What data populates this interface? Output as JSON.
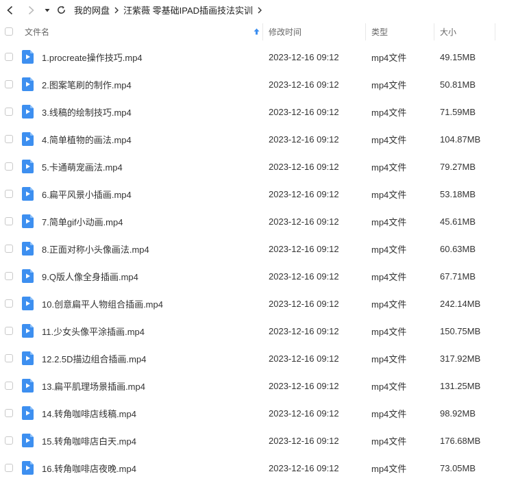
{
  "breadcrumb": [
    "我的网盘",
    "汪紫薇 零基础IPAD插画技法实训"
  ],
  "columns": {
    "name": "文件名",
    "modified": "修改时间",
    "type": "类型",
    "size": "大小"
  },
  "colors": {
    "icon_blue": "#3d8ff0",
    "sort_arrow": "#3d8ff0"
  },
  "files": [
    {
      "name": "1.procreate操作技巧.mp4",
      "date": "2023-12-16 09:12",
      "type": "mp4文件",
      "size": "49.15MB"
    },
    {
      "name": "2.图案笔刷的制作.mp4",
      "date": "2023-12-16 09:12",
      "type": "mp4文件",
      "size": "50.81MB"
    },
    {
      "name": "3.线稿的绘制技巧.mp4",
      "date": "2023-12-16 09:12",
      "type": "mp4文件",
      "size": "71.59MB"
    },
    {
      "name": "4.简单植物的画法.mp4",
      "date": "2023-12-16 09:12",
      "type": "mp4文件",
      "size": "104.87MB"
    },
    {
      "name": "5.卡通萌宠画法.mp4",
      "date": "2023-12-16 09:12",
      "type": "mp4文件",
      "size": "79.27MB"
    },
    {
      "name": "6.扁平风景小插画.mp4",
      "date": "2023-12-16 09:12",
      "type": "mp4文件",
      "size": "53.18MB"
    },
    {
      "name": "7.简单gif小动画.mp4",
      "date": "2023-12-16 09:12",
      "type": "mp4文件",
      "size": "45.61MB"
    },
    {
      "name": "8.正面对称小头像画法.mp4",
      "date": "2023-12-16 09:12",
      "type": "mp4文件",
      "size": "60.63MB"
    },
    {
      "name": "9.Q版人像全身插画.mp4",
      "date": "2023-12-16 09:12",
      "type": "mp4文件",
      "size": "67.71MB"
    },
    {
      "name": "10.创意扁平人物组合插画.mp4",
      "date": "2023-12-16 09:12",
      "type": "mp4文件",
      "size": "242.14MB"
    },
    {
      "name": "11.少女头像平涂插画.mp4",
      "date": "2023-12-16 09:12",
      "type": "mp4文件",
      "size": "150.75MB"
    },
    {
      "name": "12.2.5D描边组合插画.mp4",
      "date": "2023-12-16 09:12",
      "type": "mp4文件",
      "size": "317.92MB"
    },
    {
      "name": "13.扁平肌理场景插画.mp4",
      "date": "2023-12-16 09:12",
      "type": "mp4文件",
      "size": "131.25MB"
    },
    {
      "name": "14.转角咖啡店线稿.mp4",
      "date": "2023-12-16 09:12",
      "type": "mp4文件",
      "size": "98.92MB"
    },
    {
      "name": "15.转角咖啡店白天.mp4",
      "date": "2023-12-16 09:12",
      "type": "mp4文件",
      "size": "176.68MB"
    },
    {
      "name": "16.转角咖啡店夜晚.mp4",
      "date": "2023-12-16 09:12",
      "type": "mp4文件",
      "size": "73.05MB"
    }
  ]
}
